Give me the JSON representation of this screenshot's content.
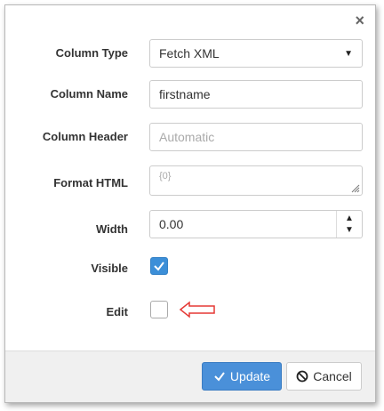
{
  "dialog": {
    "close_label": "×",
    "fields": {
      "column_type": {
        "label": "Column Type",
        "value": "Fetch XML"
      },
      "column_name": {
        "label": "Column Name",
        "value": "firstname"
      },
      "column_header": {
        "label": "Column Header",
        "placeholder": "Automatic"
      },
      "format_html": {
        "label": "Format HTML",
        "placeholder": "{0}"
      },
      "width": {
        "label": "Width",
        "value": "0.00"
      },
      "visible": {
        "label": "Visible",
        "checked": true
      },
      "edit": {
        "label": "Edit",
        "checked": false
      }
    },
    "buttons": {
      "update": "Update",
      "cancel": "Cancel"
    },
    "colors": {
      "primary": "#4a90d9",
      "checkbox_checked": "#3c8fd8",
      "annotation_arrow": "#e53935"
    }
  }
}
